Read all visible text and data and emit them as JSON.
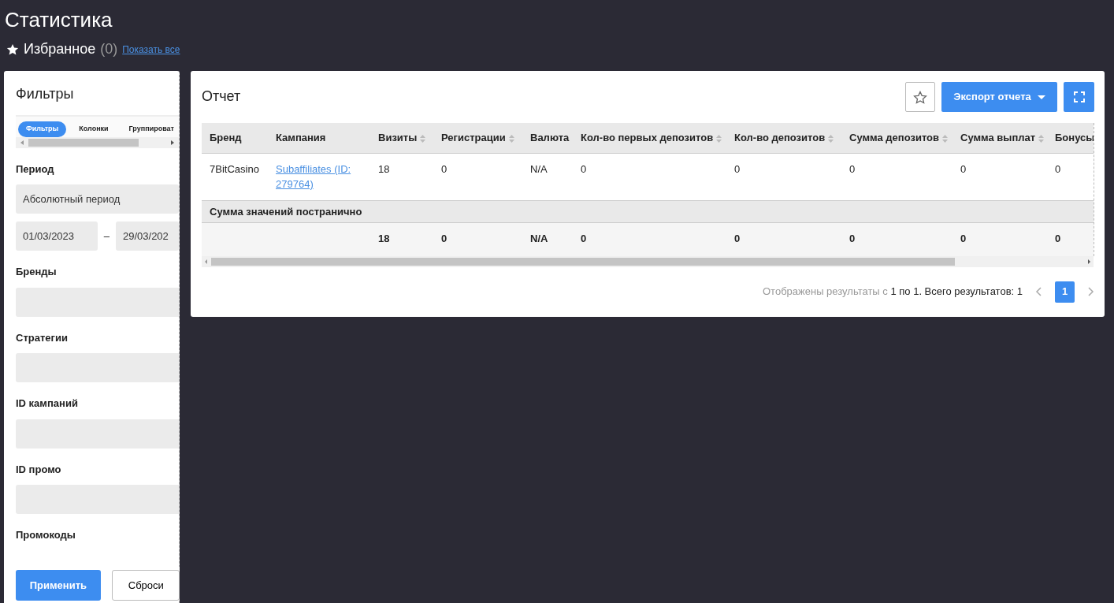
{
  "page_title": "Статистика",
  "favorites": {
    "label": "Избранное",
    "count": "(0)",
    "link": "Показать все"
  },
  "filters": {
    "title": "Фильтры",
    "tabs": [
      {
        "label": "Фильтры",
        "selected": true
      },
      {
        "label": "Колонки",
        "selected": false
      },
      {
        "label": "Группироват",
        "selected": false
      }
    ],
    "fields": [
      {
        "label": "Период",
        "kind": "select",
        "value": "Абсолютный период"
      },
      {
        "kind": "range",
        "from": "01/03/2023",
        "to": "29/03/202"
      },
      {
        "label": "Бренды",
        "kind": "text"
      },
      {
        "label": "Стратегии",
        "kind": "text"
      },
      {
        "label": "ID кампаний",
        "kind": "text"
      },
      {
        "label": "ID промо",
        "kind": "text"
      },
      {
        "label": "Промокоды",
        "kind": "label"
      }
    ],
    "range_separator": "–",
    "apply_button": "Применить",
    "reset_button": "Сброси"
  },
  "report": {
    "title": "Отчет",
    "export_button": "Экспорт отчета",
    "columns": [
      {
        "label": "Бренд",
        "sortable": false
      },
      {
        "label": "Кампания",
        "sortable": false
      },
      {
        "label": "Визиты",
        "sortable": true
      },
      {
        "label": "Регистрации",
        "sortable": true
      },
      {
        "label": "Валюта",
        "sortable": false
      },
      {
        "label": "Кол-во первых депозитов",
        "sortable": true
      },
      {
        "label": "Кол-во депозитов",
        "sortable": true
      },
      {
        "label": "Сумма депозитов",
        "sortable": true
      },
      {
        "label": "Сумма выплат",
        "sortable": true
      },
      {
        "label": "Бонусы",
        "sortable": false
      }
    ],
    "rows": [
      [
        {
          "kind": "text",
          "text": "7BitCasino"
        },
        {
          "kind": "link",
          "text": "Subaffiliates (ID: 279764)"
        },
        {
          "kind": "text",
          "text": "18"
        },
        {
          "kind": "text",
          "text": "0"
        },
        {
          "kind": "text",
          "text": "N/A"
        },
        {
          "kind": "text",
          "text": "0"
        },
        {
          "kind": "text",
          "text": "0"
        },
        {
          "kind": "text",
          "text": "0"
        },
        {
          "kind": "text",
          "text": "0"
        },
        {
          "kind": "text",
          "text": "0"
        }
      ]
    ],
    "subtotal_label": "Сумма значений постранично",
    "totals": [
      "18",
      "0",
      "N/A",
      "0",
      "0",
      "0",
      "0",
      "0"
    ],
    "summary_prefix": "Отображены результаты с ",
    "summary_rest": "1 по 1. Всего результатов: 1",
    "pages": [
      {
        "label": "1",
        "selected": true
      }
    ]
  }
}
